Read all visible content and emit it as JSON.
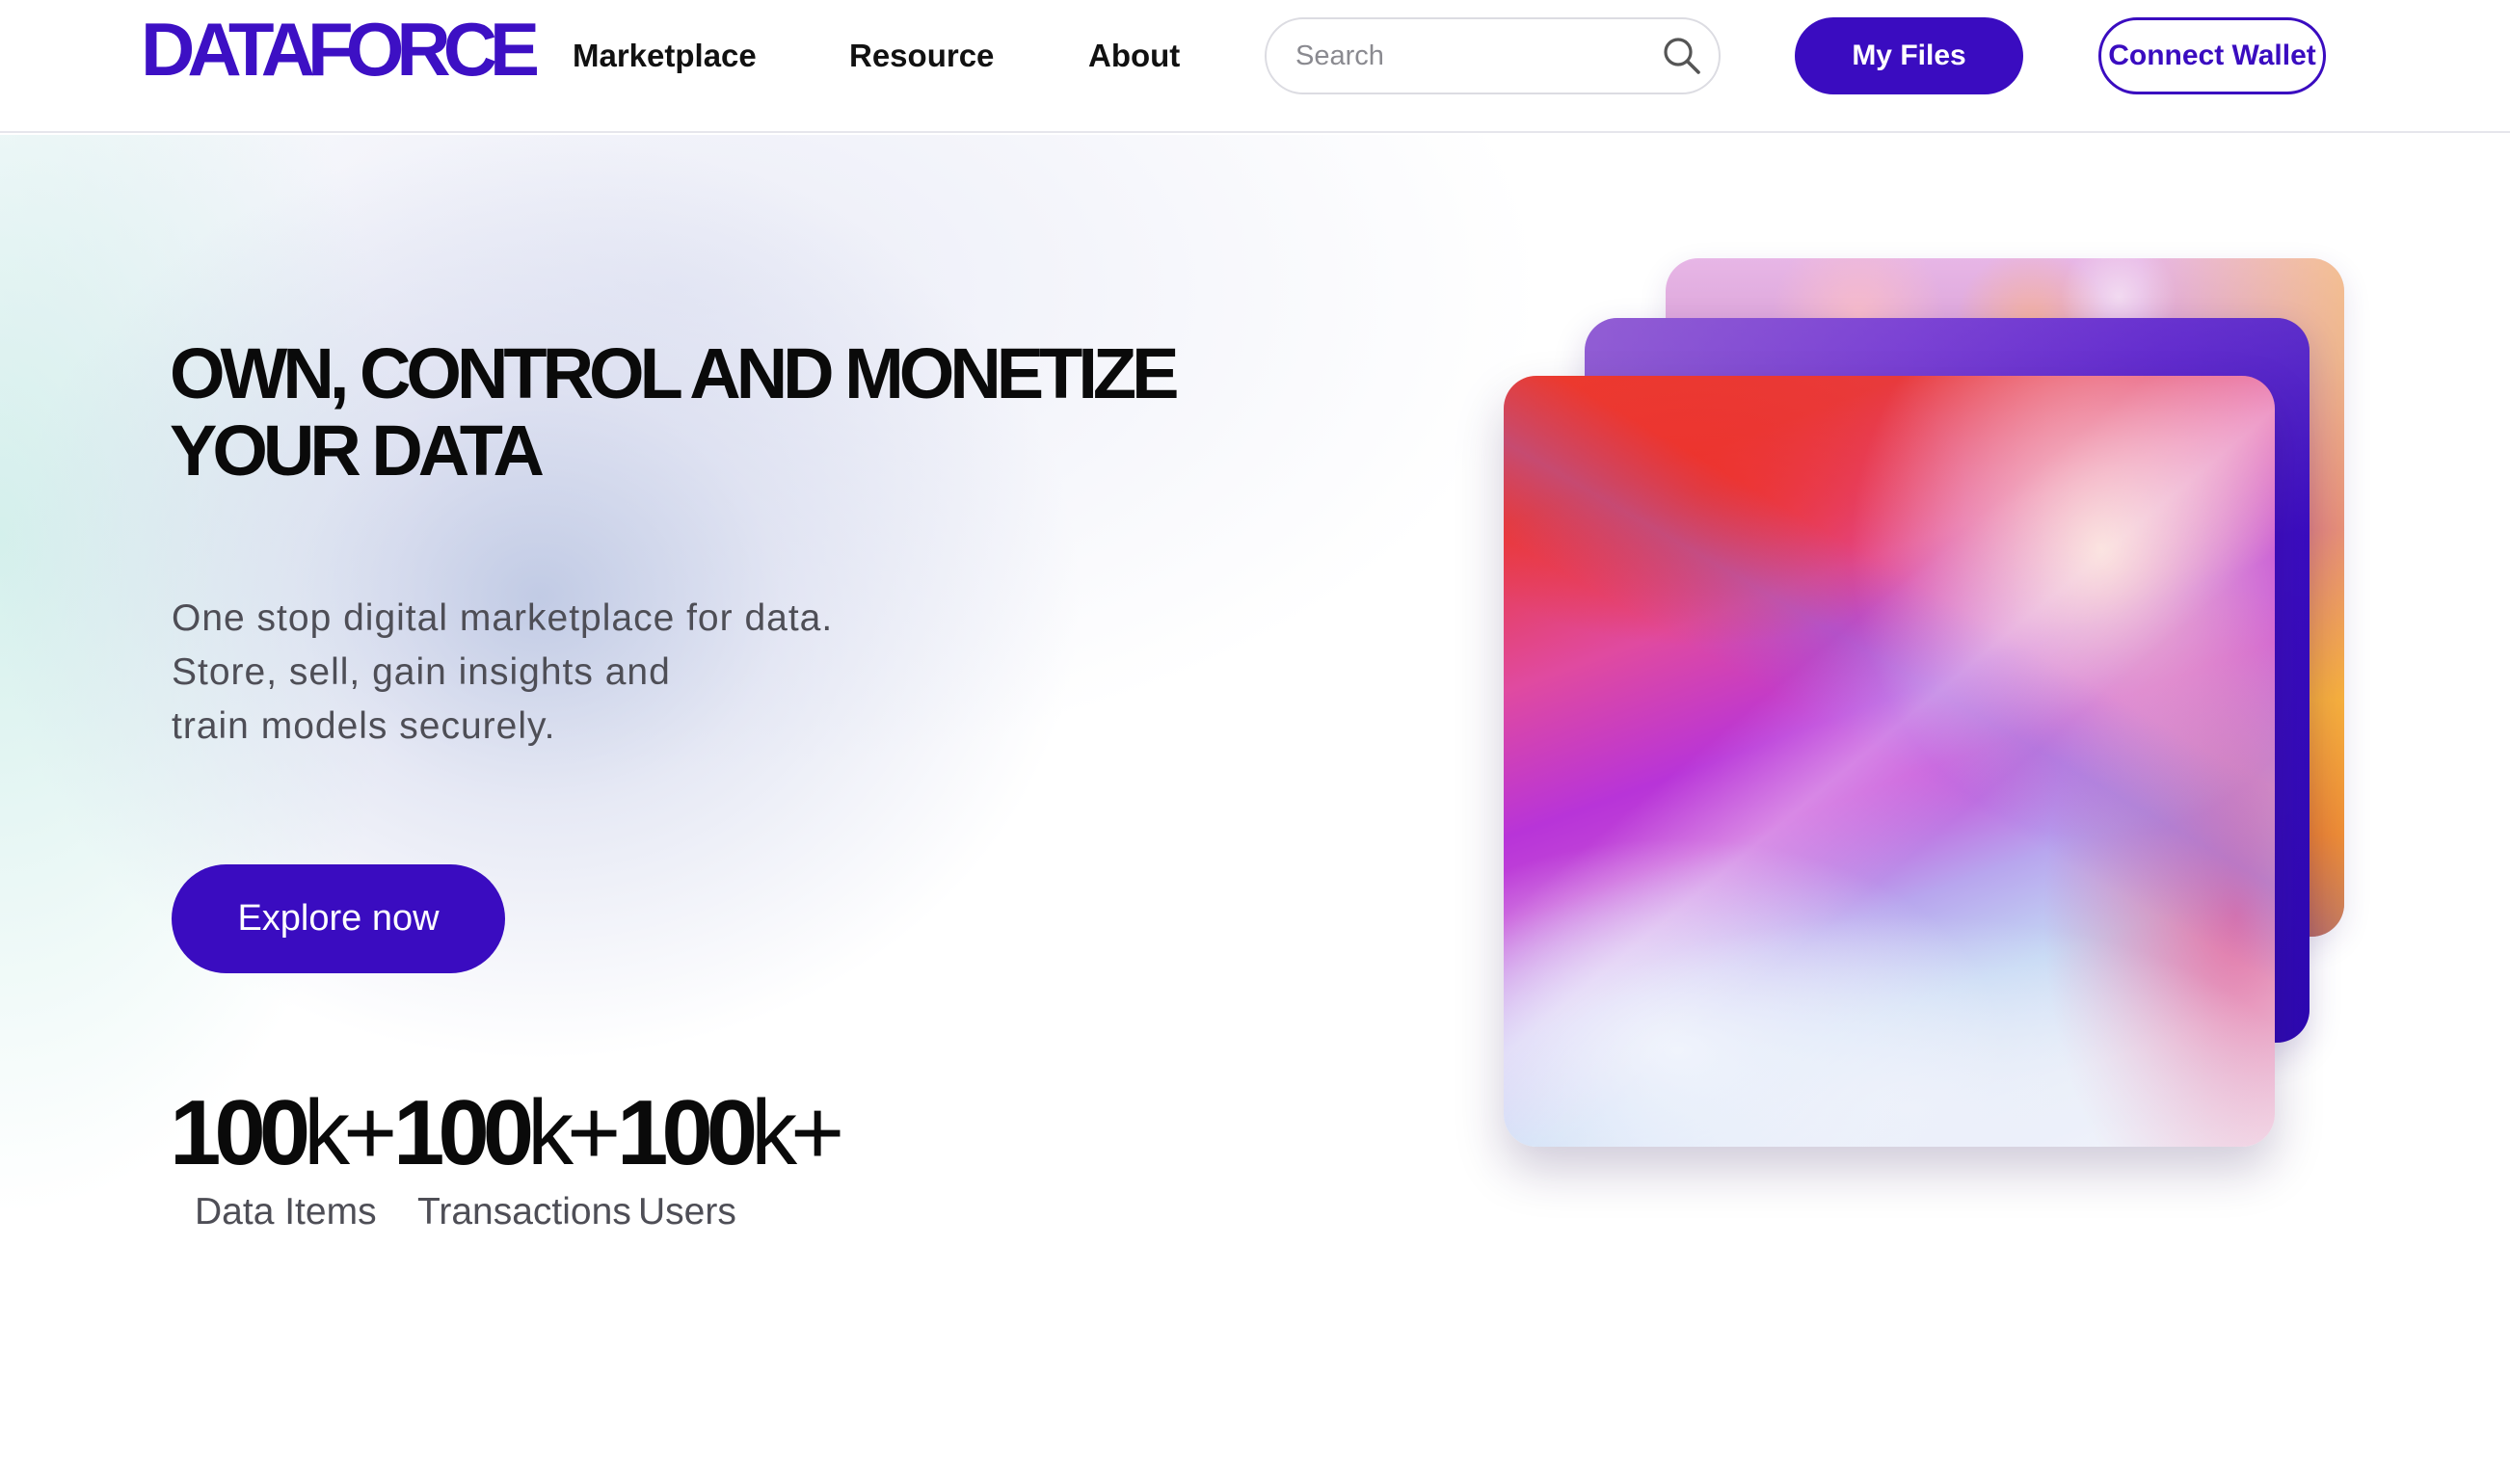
{
  "brand": {
    "logo_text": "DATAFORCE",
    "accent_color": "#3a0cc0"
  },
  "nav": {
    "items": [
      {
        "label": "Marketplace"
      },
      {
        "label": "Resource"
      },
      {
        "label": "About"
      }
    ]
  },
  "search": {
    "placeholder": "Search",
    "value": "",
    "icon": "search-icon"
  },
  "header_actions": {
    "my_files_label": "My Files",
    "connect_wallet_label": "Connect Wallet"
  },
  "hero": {
    "title_lines": [
      "OWN, CONTROL AND MONETIZE",
      "YOUR DATA"
    ],
    "description_lines": [
      "One stop digital marketplace for data.",
      "Store, sell, gain insights and",
      "train models securely."
    ],
    "cta_label": "Explore now"
  },
  "stats": [
    {
      "number": "100",
      "suffix": "k+",
      "label": "Data Items"
    },
    {
      "number": "100",
      "suffix": "k+",
      "label": "Transactions"
    },
    {
      "number": "100",
      "suffix": "k+",
      "label": "Users"
    }
  ]
}
